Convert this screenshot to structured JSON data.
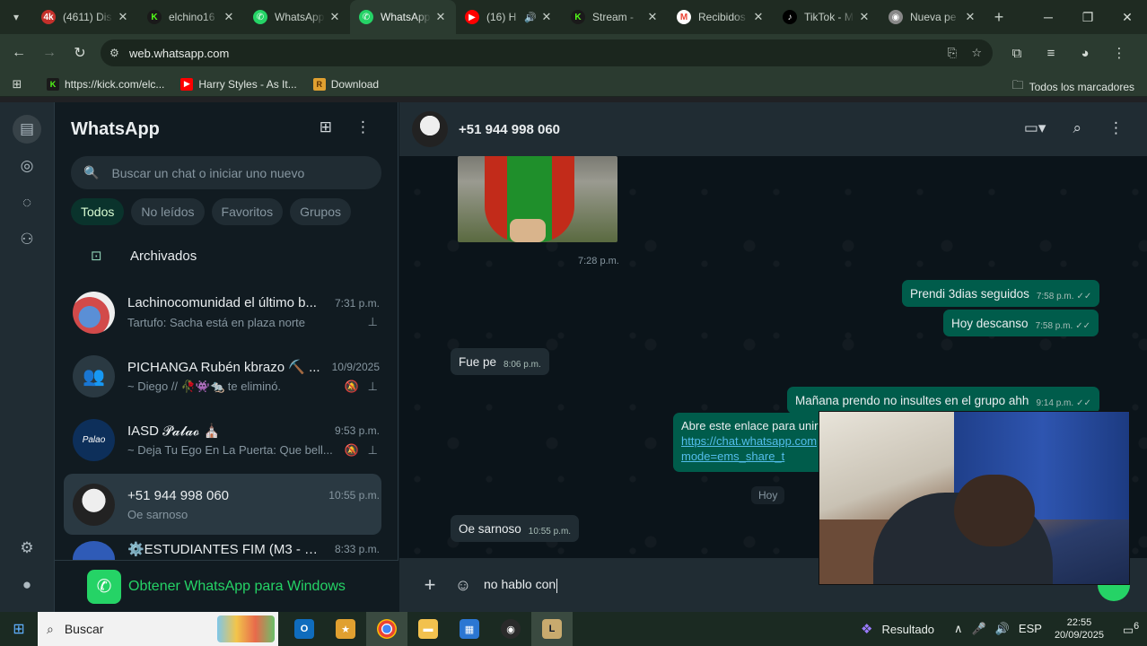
{
  "browser": {
    "tabs": [
      {
        "title": "(4611) Dis",
        "fav_color": "#c4302b",
        "fav_text": "4k"
      },
      {
        "title": "elchino16",
        "fav_color": "#53fc18",
        "fav_text": "K"
      },
      {
        "title": "WhatsApp",
        "fav_color": "#25d366",
        "fav_text": "✆"
      },
      {
        "title": "WhatsApp",
        "fav_color": "#25d366",
        "fav_text": "✆"
      },
      {
        "title": "(16) H",
        "fav_color": "#ff0000",
        "fav_text": "▶"
      },
      {
        "title": "Stream - ",
        "fav_color": "#53fc18",
        "fav_text": "K"
      },
      {
        "title": "Recibidos",
        "fav_color": "#ea4335",
        "fav_text": "M"
      },
      {
        "title": "TikTok - M",
        "fav_color": "#000000",
        "fav_text": "♪"
      },
      {
        "title": "Nueva pe",
        "fav_color": "#888888",
        "fav_text": "◉"
      }
    ],
    "url": "web.whatsapp.com",
    "bookmarks": [
      {
        "label": "https://kick.com/elc...",
        "fav_color": "#53fc18",
        "fav_text": "K"
      },
      {
        "label": "Harry Styles - As It...",
        "fav_color": "#ff0000",
        "fav_text": "▶"
      },
      {
        "label": "Download",
        "fav_color": "#e0a030",
        "fav_text": "R"
      }
    ],
    "all_bookmarks": "Todos los marcadores"
  },
  "sidebar": {
    "title": "WhatsApp",
    "search_placeholder": "Buscar un chat o iniciar uno nuevo",
    "filters": [
      "Todos",
      "No leídos",
      "Favoritos",
      "Grupos"
    ],
    "archived": "Archivados",
    "chats": [
      {
        "name": "Lachinocomunidad el último b...",
        "time": "7:31 p.m.",
        "preview": "Tartufo: Sacha está en plaza norte",
        "icons": "📌"
      },
      {
        "name": "PICHANGA Rubén kbrazo ⛏️ ...",
        "time": "10/9/2025",
        "preview": "~ Diego // 🥀👾🐀 te eliminó.",
        "icons": "🔕 📌"
      },
      {
        "name": "IASD 𝓟𝓪𝓵𝓪𝓸 ⛪",
        "time": "9:53 p.m.",
        "preview": "~ Deja Tu Ego En La Puerta: Que bell...",
        "icons": "🔕 📌"
      },
      {
        "name": "+51 944 998 060",
        "time": "10:55 p.m.",
        "preview": "Oe sarnoso",
        "icons": ""
      },
      {
        "name": "⚙️ESTUDIANTES FIM (M3 - M4...",
        "time": "8:33 p.m.",
        "preview": "",
        "icons": ""
      }
    ],
    "promo": "Obtener WhatsApp para Windows"
  },
  "conversation": {
    "contact": "+51 944 998 060",
    "media_time": "7:28 p.m.",
    "messages": [
      {
        "text": "Prendi 3dias seguidos",
        "time": "7:58 p.m."
      },
      {
        "text": "Hoy descanso",
        "time": "7:58 p.m."
      },
      {
        "text": "Fue pe",
        "time": "8:06 p.m."
      },
      {
        "text": "Mañana prendo no insultes en el grupo ahh",
        "time": "9:14 p.m."
      },
      {
        "text": "Oe sarnoso",
        "time": "10:55 p.m."
      }
    ],
    "link_message": {
      "text": "Abre este enlace para unir",
      "link1": "https://chat.whatsapp.com",
      "link2": "mode=ems_share_t"
    },
    "day_divider": "Hoy",
    "composer_text": "no hablo con"
  },
  "taskbar": {
    "search": "Buscar",
    "widget": "Resultado",
    "lang": "ESP",
    "time": "22:55",
    "date": "20/09/2025",
    "notif_count": "6"
  }
}
